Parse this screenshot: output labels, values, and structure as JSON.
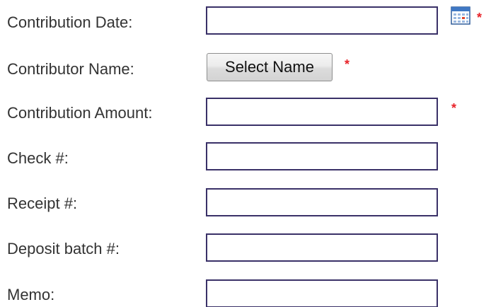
{
  "form": {
    "contribution_date": {
      "label": "Contribution Date:",
      "value": "",
      "required_marker": "*"
    },
    "contributor_name": {
      "label": "Contributor Name:",
      "button_label": "Select Name",
      "required_marker": "*"
    },
    "contribution_amount": {
      "label": "Contribution Amount:",
      "value": "",
      "required_marker": "*"
    },
    "check_number": {
      "label": "Check #:",
      "value": ""
    },
    "receipt_number": {
      "label": "Receipt #:",
      "value": ""
    },
    "deposit_batch": {
      "label": "Deposit batch #:",
      "value": ""
    },
    "memo": {
      "label": "Memo:",
      "value": ""
    }
  },
  "icons": {
    "calendar": "calendar-icon"
  },
  "colors": {
    "field_border": "#3a3168",
    "required_marker": "#e8242a",
    "label_text": "#333333"
  }
}
